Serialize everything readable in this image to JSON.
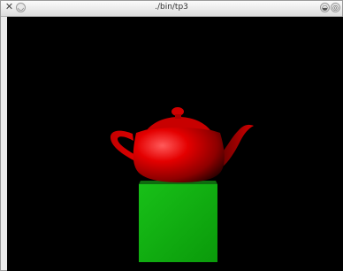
{
  "window": {
    "title": "./bin/tp3",
    "icons": {
      "close": "close-icon",
      "menu": "window-menu-icon",
      "minimize": "minimize-icon",
      "maximize": "maximize-icon"
    },
    "glyphs": {
      "close": "✕",
      "menu": "◡",
      "minimize": "◒",
      "maximize": "◎"
    }
  },
  "scene": {
    "background": "#000000",
    "objects": [
      {
        "name": "teapot",
        "color": "#d40000"
      },
      {
        "name": "cube",
        "color": "#12b512"
      }
    ]
  }
}
